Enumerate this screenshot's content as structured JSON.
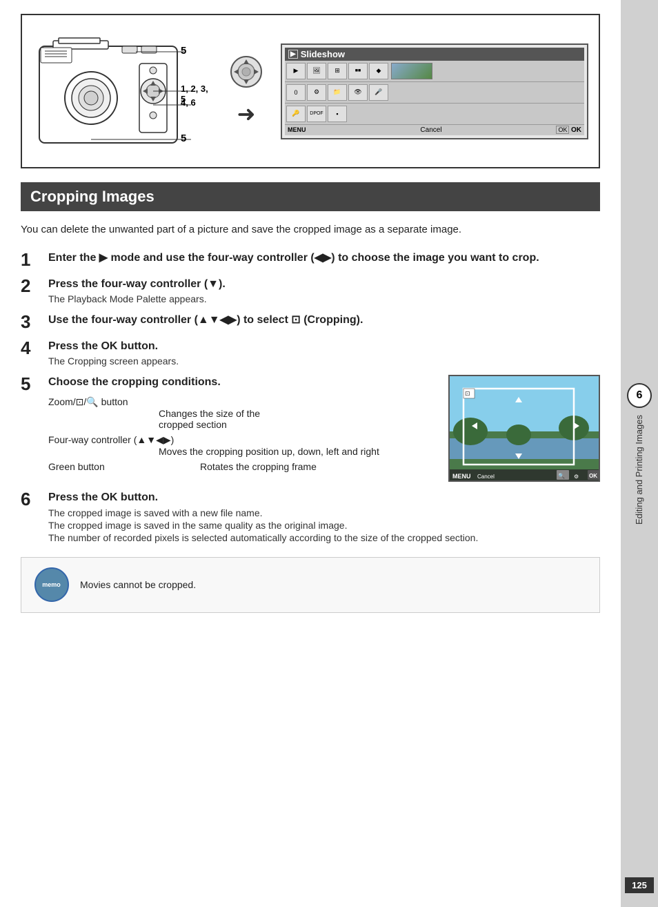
{
  "diagram": {
    "title": "Slideshow",
    "labels": {
      "label5_top": "5",
      "label123_5": "1, 2, 3, 5",
      "label4_6": "4, 6",
      "label5_bot": "5"
    },
    "screen": {
      "title": "Slideshow",
      "cancel_label": "Cancel",
      "ok_label": "OK"
    }
  },
  "section": {
    "heading": "Cropping Images"
  },
  "intro": {
    "text": "You can delete the unwanted part of a picture and save the cropped image as a separate image."
  },
  "steps": [
    {
      "number": "1",
      "title": "Enter the ▶ mode and use the four-way controller (◀▶) to choose the image you want to crop."
    },
    {
      "number": "2",
      "title": "Press the four-way controller (▼).",
      "sub": "The Playback Mode Palette appears."
    },
    {
      "number": "3",
      "title": "Use the four-way controller (▲▼◀▶) to select ⊡ (Cropping)."
    },
    {
      "number": "4",
      "title": "Press the OK button.",
      "sub": "The Cropping screen appears."
    },
    {
      "number": "5",
      "title": "Choose the cropping conditions.",
      "conditions": [
        {
          "label": "Zoom/⊡/🔍 button",
          "desc": "",
          "sub": "Changes the size of the cropped section"
        },
        {
          "label": "Four-way controller (▲▼◀▶)",
          "desc": "",
          "sub": "Moves the cropping position up, down, left and right"
        },
        {
          "label": "Green button",
          "desc": "Rotates the cropping frame"
        }
      ]
    },
    {
      "number": "6",
      "title": "Press the OK button.",
      "sub1": "The cropped image is saved with a new file name.",
      "sub2": "The cropped image is saved in the same quality as the original image.",
      "sub3": "The number of recorded pixels is selected automatically according to the size of the cropped section."
    }
  ],
  "memo": {
    "label": "memo",
    "text": "Movies cannot be cropped."
  },
  "chapter": {
    "number": "6",
    "text": "Editing and Printing Images"
  },
  "page_number": "125"
}
